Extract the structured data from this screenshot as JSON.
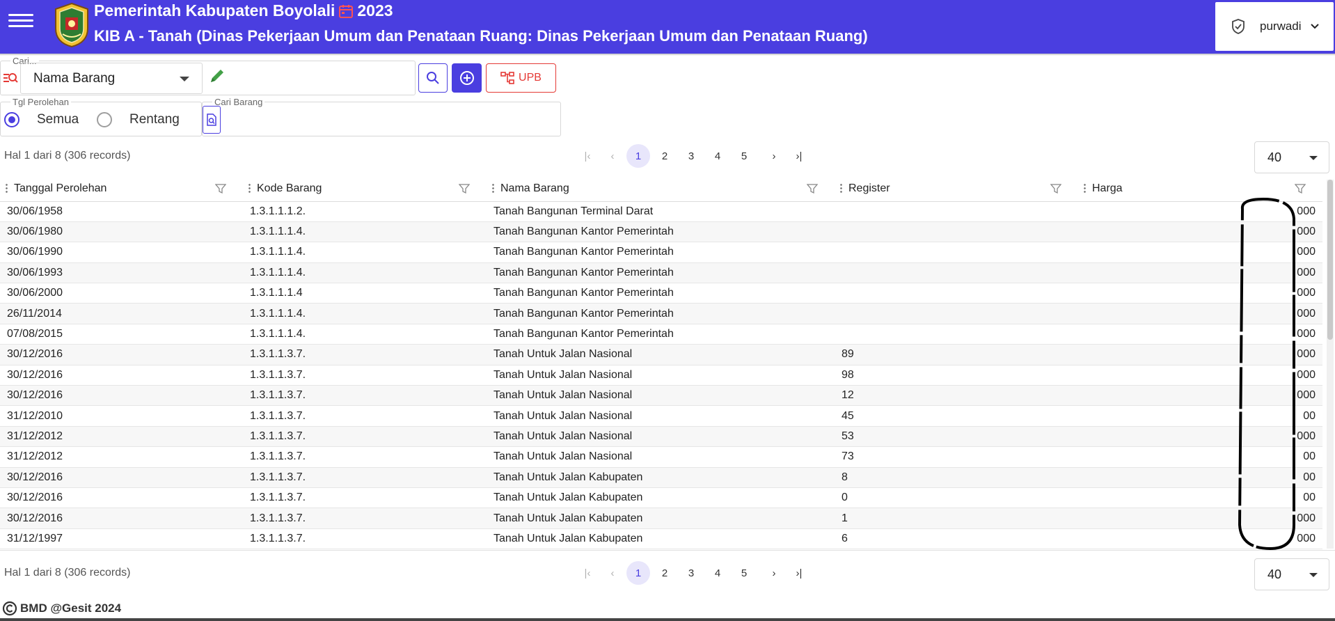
{
  "header": {
    "title": "Pemerintah Kabupaten Boyolali",
    "year": "2023",
    "subtitle": "KIB A - Tanah  (Dinas Pekerjaan Umum dan Penataan Ruang: Dinas Pekerjaan Umum dan Penataan Ruang)",
    "user": "purwadi",
    "color": "#4a3ee0"
  },
  "search": {
    "legend": "Cari...",
    "field": "Nama Barang",
    "value": "",
    "upb_label": "UPB"
  },
  "date_filter": {
    "legend": "Tgl Perolehan",
    "options": [
      "Semua",
      "Rentang"
    ],
    "selected": "Semua"
  },
  "cari_barang": {
    "legend": "Cari Barang"
  },
  "pagination": {
    "info": "Hal 1 dari 8 (306 records)",
    "pages": [
      "1",
      "2",
      "3",
      "4",
      "5"
    ],
    "current": "1",
    "per_page": "40"
  },
  "table": {
    "columns": [
      "Tanggal Perolehan",
      "Kode Barang",
      "Nama Barang",
      "Register",
      "Harga"
    ],
    "rows": [
      {
        "tanggal": "30/06/1958",
        "kode": "1.3.1.1.1.2.",
        "nama": "Tanah Bangunan Terminal Darat",
        "register": "",
        "harga": "000"
      },
      {
        "tanggal": "30/06/1980",
        "kode": "1.3.1.1.1.4.",
        "nama": "Tanah Bangunan Kantor Pemerintah",
        "register": "",
        "harga": "000"
      },
      {
        "tanggal": "30/06/1990",
        "kode": "1.3.1.1.1.4.",
        "nama": "Tanah Bangunan Kantor Pemerintah",
        "register": "",
        "harga": "000"
      },
      {
        "tanggal": "30/06/1993",
        "kode": "1.3.1.1.1.4.",
        "nama": "Tanah Bangunan Kantor Pemerintah",
        "register": "",
        "harga": "000"
      },
      {
        "tanggal": "30/06/2000",
        "kode": "1.3.1.1.1.4",
        "nama": "Tanah Bangunan Kantor Pemerintah",
        "register": "",
        "harga": "000"
      },
      {
        "tanggal": "26/11/2014",
        "kode": "1.3.1.1.1.4.",
        "nama": "Tanah Bangunan Kantor Pemerintah",
        "register": "",
        "harga": "000"
      },
      {
        "tanggal": "07/08/2015",
        "kode": "1.3.1.1.1.4.",
        "nama": "Tanah Bangunan Kantor Pemerintah",
        "register": "",
        "harga": "000"
      },
      {
        "tanggal": "30/12/2016",
        "kode": "1.3.1.1.3.7.",
        "nama": "Tanah Untuk Jalan Nasional",
        "register": "89",
        "harga": "000"
      },
      {
        "tanggal": "30/12/2016",
        "kode": "1.3.1.1.3.7.",
        "nama": "Tanah Untuk Jalan Nasional",
        "register": "98",
        "harga": "000"
      },
      {
        "tanggal": "30/12/2016",
        "kode": "1.3.1.1.3.7.",
        "nama": "Tanah Untuk Jalan Nasional",
        "register": "12",
        "harga": "000"
      },
      {
        "tanggal": "31/12/2010",
        "kode": "1.3.1.1.3.7.",
        "nama": "Tanah Untuk Jalan Nasional",
        "register": "45",
        "harga": "00"
      },
      {
        "tanggal": "31/12/2012",
        "kode": "1.3.1.1.3.7.",
        "nama": "Tanah Untuk Jalan Nasional",
        "register": "53",
        "harga": "000"
      },
      {
        "tanggal": "31/12/2012",
        "kode": "1.3.1.1.3.7.",
        "nama": "Tanah Untuk Jalan Nasional",
        "register": "73",
        "harga": "00"
      },
      {
        "tanggal": "30/12/2016",
        "kode": "1.3.1.1.3.7.",
        "nama": "Tanah Untuk Jalan Kabupaten",
        "register": "8",
        "harga": "00"
      },
      {
        "tanggal": "30/12/2016",
        "kode": "1.3.1.1.3.7.",
        "nama": "Tanah Untuk Jalan Kabupaten",
        "register": "0",
        "harga": "00"
      },
      {
        "tanggal": "30/12/2016",
        "kode": "1.3.1.1.3.7.",
        "nama": "Tanah Untuk Jalan Kabupaten",
        "register": "1",
        "harga": "000"
      },
      {
        "tanggal": "31/12/1997",
        "kode": "1.3.1.1.3.7.",
        "nama": "Tanah Untuk Jalan Kabupaten",
        "register": "6",
        "harga": "000"
      }
    ]
  },
  "footer": {
    "text": "BMD @Gesit 2024"
  },
  "icons": {
    "menu": "hamburger-icon",
    "calendar": "calendar-icon",
    "shield": "shield-icon",
    "search": "search-icon",
    "add": "add-circle-icon",
    "upb": "sitemap-icon",
    "filter": "filter-icon",
    "copyright": "copyright-icon"
  }
}
